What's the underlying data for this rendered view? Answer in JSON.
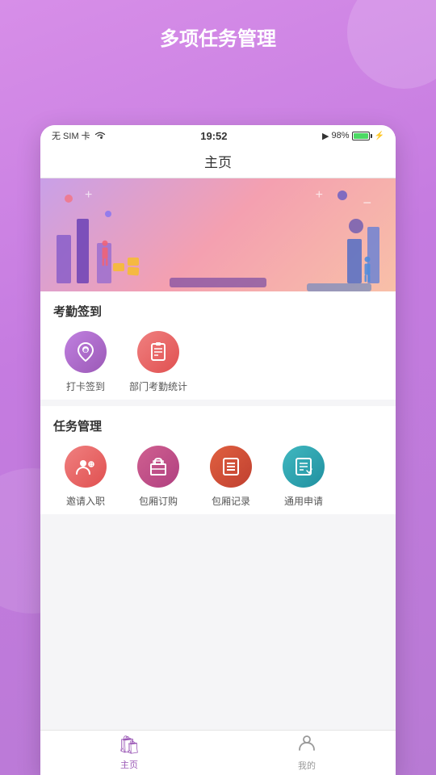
{
  "app": {
    "title": "多项任务管理"
  },
  "statusBar": {
    "carrier": "无 SIM 卡",
    "wifi": "WiFi",
    "time": "19:52",
    "signal": "▶",
    "battery": "98%"
  },
  "navBar": {
    "title": "主页"
  },
  "sections": {
    "attendance": {
      "title": "考勤签到",
      "items": [
        {
          "id": "checkin",
          "label": "打卡签到",
          "icon": "📍",
          "colorClass": "purple-grad"
        },
        {
          "id": "dept-stats",
          "label": "部门考勤统计",
          "icon": "📋",
          "colorClass": "pink-grad"
        }
      ]
    },
    "taskManagement": {
      "title": "任务管理",
      "items": [
        {
          "id": "invite",
          "label": "邀请入职",
          "icon": "👤",
          "colorClass": "pink-grad"
        },
        {
          "id": "package-buy",
          "label": "包厢订购",
          "icon": "🏢",
          "colorClass": "violet-pink-grad"
        },
        {
          "id": "package-records",
          "label": "包厢记录",
          "icon": "📑",
          "colorClass": "red-grad"
        },
        {
          "id": "general-apply",
          "label": "通用申请",
          "icon": "📋",
          "colorClass": "cyan-grad"
        }
      ]
    }
  },
  "tabBar": {
    "tabs": [
      {
        "id": "home",
        "label": "主页",
        "icon": "🛍",
        "active": true
      },
      {
        "id": "mine",
        "label": "我的",
        "icon": "👤",
        "active": false
      }
    ]
  }
}
